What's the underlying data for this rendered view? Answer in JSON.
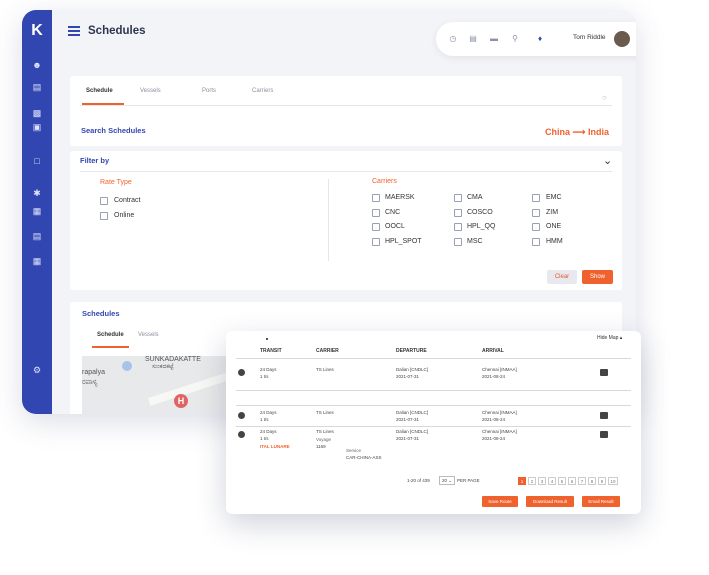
{
  "app": {
    "logo": "K"
  },
  "header": {
    "title": "Schedules",
    "user_name": "Tom Riddle"
  },
  "sidebar": {
    "icons": [
      "user-icon",
      "ship-icon",
      "truck-icon",
      "card-icon",
      "document-icon",
      "settings-cog-icon",
      "calculator-icon",
      "report-icon",
      "calendar-icon",
      "gear-icon"
    ]
  },
  "search_card": {
    "tabs": [
      "Schedule",
      "Vessels",
      "Ports",
      "Carriers"
    ],
    "search_link": "Search Schedules",
    "origin": "China",
    "arrow": "⟶",
    "destination": "India"
  },
  "filter": {
    "title": "Filter by",
    "rate_type_label": "Rate Type",
    "rate_types": [
      "Contract",
      "Online"
    ],
    "carriers_label": "Carriers",
    "carriers": [
      "MAERSK",
      "CMA",
      "EMC",
      "CNC",
      "COSCO",
      "ZIM",
      "OOCL",
      "HPL_QQ",
      "ONE",
      "HPL_SPOT",
      "MSC",
      "HMM"
    ],
    "clear_label": "Clear",
    "show_label": "Show"
  },
  "schedules_card": {
    "title": "Schedules",
    "tabs": [
      "Schedule",
      "Vessels"
    ],
    "map_labels": [
      "SUNKADAKATTE",
      "ಸುಂಕದಕಟ್ಟೆ",
      "rapalya",
      "ರಪಾಳ್ಯ"
    ]
  },
  "results": {
    "hide_map": "Hide Map ▴",
    "columns": [
      "TRANSIT",
      "CARRIER",
      "DEPARTURE",
      "ARRIVAL"
    ],
    "rows": [
      {
        "transit": "24 Days",
        "tranship": "1 t/s",
        "carrier": "TS Lines",
        "dep_port": "Dalian [CNDLC]",
        "dep_date": "2021-07-31",
        "arr_port": "Chennai [INMAA]",
        "arr_date": "2021-08-24"
      },
      {
        "transit": "24 Days",
        "tranship": "1 t/s",
        "carrier": "TS Lines",
        "dep_port": "Dalian [CNDLC]",
        "dep_date": "2021-07-31",
        "arr_port": "Chennai [INMAA]",
        "arr_date": "2021-08-24"
      },
      {
        "transit": "24 Days",
        "tranship": "1 t/s",
        "carrier": "TS Lines",
        "dep_port": "Dalian [CNDLC]",
        "dep_date": "2021-07-31",
        "arr_port": "Chennai [INMAA]",
        "arr_date": "2021-08-24"
      }
    ],
    "detail": {
      "vessel_name": "ITAL LUNARE",
      "voyage_label": "Voyage",
      "voyage": "1169",
      "service_label": "Service",
      "service": "CAR-CHINA-ASS"
    },
    "pagination": {
      "summary": "1-20 of 439",
      "page_size": "20",
      "per_page_label": "PER PAGE",
      "pages": [
        "1",
        "2",
        "3",
        "4",
        "5",
        "6",
        "7",
        "8",
        "9",
        "10"
      ],
      "active_page": "1"
    },
    "actions": [
      "Save Route",
      "Download Result",
      "Email Result"
    ]
  }
}
